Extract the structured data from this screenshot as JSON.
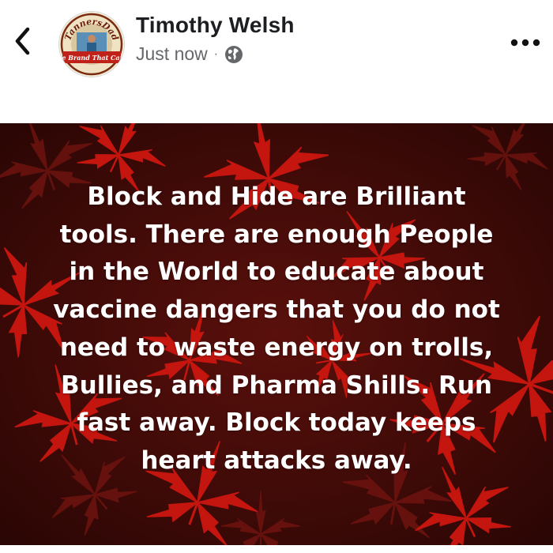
{
  "post": {
    "author_name": "Timothy Welsh",
    "timestamp": "Just now",
    "meta_separator": "·",
    "visibility_icon": "globe-icon",
    "avatar": {
      "arc_text": "TannersDad",
      "banner_text": "The Brand That Cares"
    },
    "body_text": "Block and Hide are Brilliant\ntools. There are enough People\nin the World to educate about\nvaccine dangers that you do not\nneed to waste energy on trolls,\nBullies, and Pharma Shills. Run\nfast away.  Block today keeps\nheart attacks away.",
    "background": {
      "base_color": "#3a0a08",
      "leaf_color": "#c4150f",
      "style": "red leaves on dark maroon"
    }
  },
  "nav": {
    "back_icon": "chevron-left-icon",
    "more_icon": "more-horizontal-icon"
  }
}
